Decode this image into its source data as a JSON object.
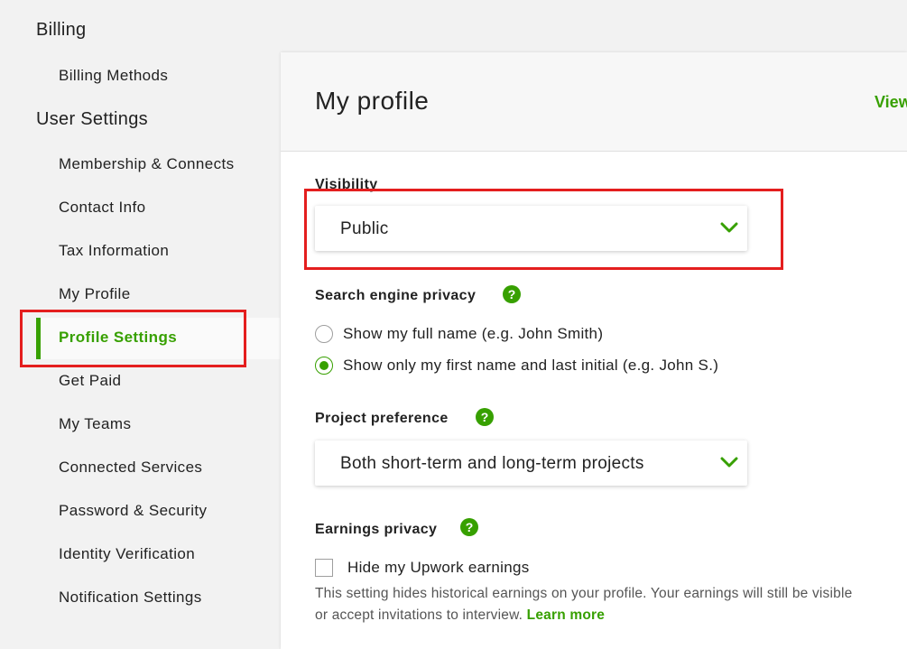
{
  "sidebar": {
    "billing_title": "Billing",
    "billing_items": [
      {
        "label": "Billing Methods"
      }
    ],
    "user_settings_title": "User Settings",
    "items": [
      {
        "label": "Membership & Connects"
      },
      {
        "label": "Contact Info"
      },
      {
        "label": "Tax Information"
      },
      {
        "label": "My Profile"
      },
      {
        "label": "Profile Settings",
        "active": true
      },
      {
        "label": "Get Paid"
      },
      {
        "label": "My Teams"
      },
      {
        "label": "Connected Services"
      },
      {
        "label": "Password & Security"
      },
      {
        "label": "Identity Verification"
      },
      {
        "label": "Notification Settings"
      }
    ]
  },
  "main": {
    "title": "My profile",
    "view_link": "View",
    "visibility": {
      "label": "Visibility",
      "value": "Public"
    },
    "search_privacy": {
      "label": "Search engine privacy",
      "options": [
        {
          "label": "Show my full name (e.g. John Smith)",
          "checked": false
        },
        {
          "label": "Show only my first name and last initial (e.g. John S.)",
          "checked": true
        }
      ]
    },
    "project_preference": {
      "label": "Project preference",
      "value": "Both short-term and long-term projects"
    },
    "earnings_privacy": {
      "label": "Earnings privacy",
      "checkbox_label": "Hide my Upwork earnings",
      "checked": false,
      "helper_line1": "This setting hides historical earnings on your profile. Your earnings will still be visible",
      "helper_line2": "or accept invitations to interview.",
      "learn_more": "Learn more"
    },
    "help_icon_glyph": "?"
  },
  "colors": {
    "accent": "#37a000",
    "highlight": "#e41e1e",
    "sidebar_bg": "#f2f2f2",
    "header_bg": "#f7f7f7"
  }
}
